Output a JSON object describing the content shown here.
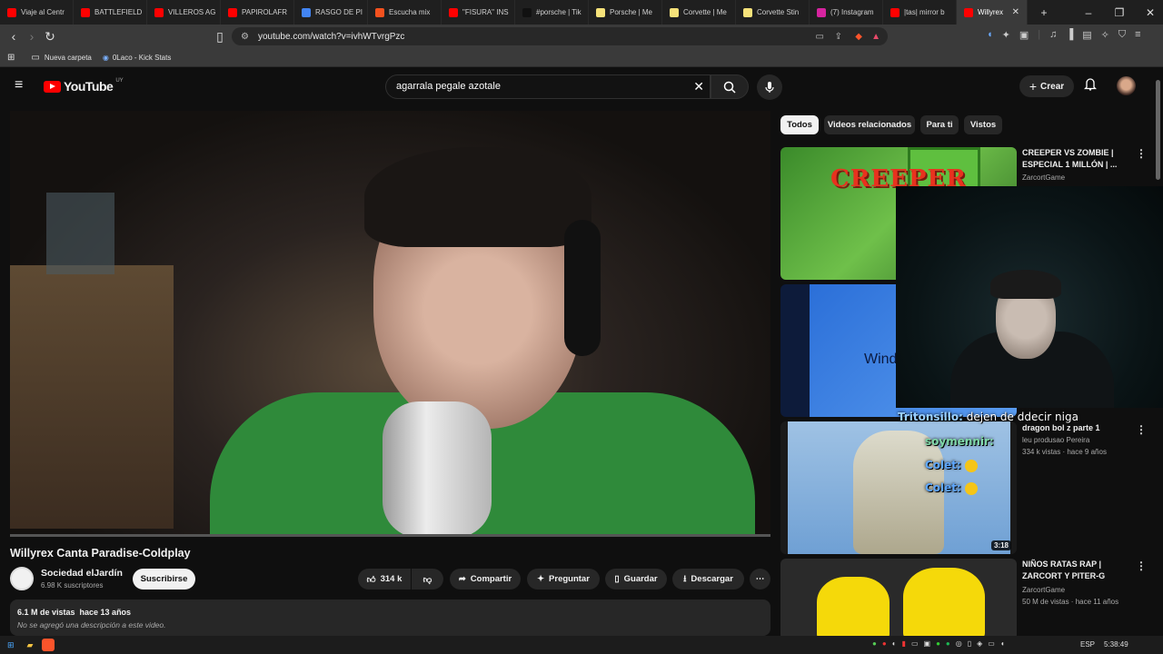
{
  "browser": {
    "tabs": [
      {
        "label": "Viaje al Centr",
        "fav": "#ff0000"
      },
      {
        "label": "BATTLEFIELD",
        "fav": "#ff0000"
      },
      {
        "label": "VILLEROS AG",
        "fav": "#ff0000"
      },
      {
        "label": "PAPIROLAFR",
        "fav": "#ff0000"
      },
      {
        "label": "RASGO DE PI",
        "fav": "#4285f4"
      },
      {
        "label": "Escucha mix",
        "fav": "#f4511e"
      },
      {
        "label": "\"FISURA\" INS",
        "fav": "#ff0000"
      },
      {
        "label": "#porsche | Tik",
        "fav": "#111111"
      },
      {
        "label": "Porsche | Me",
        "fav": "#f6e27a"
      },
      {
        "label": "Corvette | Me",
        "fav": "#f6e27a"
      },
      {
        "label": "Corvette Stin",
        "fav": "#f6e27a"
      },
      {
        "label": "(7) Instagram",
        "fav": "#d6249f"
      },
      {
        "label": "|tas| mirror b",
        "fav": "#ff0000"
      },
      {
        "label": "Willyrex",
        "fav": "#ff0000"
      }
    ],
    "url": "youtube.com/watch?v=ivhWTvrgPzc",
    "bookmarks": [
      "Nueva carpeta",
      "0Laco - Kick Stats"
    ]
  },
  "youtube": {
    "logo": "YouTube",
    "region": "UY",
    "search_query": "agarrala pegale azotale",
    "create_label": "Crear",
    "video_title": "Willyrex Canta Paradise-Coldplay",
    "channel_name": "Sociedad elJardín",
    "subscribers": "6.98 K suscriptores",
    "subscribe_label": "Suscribirse",
    "likes": "314 k",
    "share": "Compartir",
    "ask": "Preguntar",
    "save": "Guardar",
    "download": "Descargar",
    "views_date": "6.1 M de vistas  hace 13 años",
    "description": "No se agregó una descripción a este video.",
    "chips": [
      "Todos",
      "Videos relacionados",
      "Para ti",
      "Vistos"
    ],
    "related": [
      {
        "title": "CREEPER VS ZOMBIE | ESPECIAL 1 MILLÓN | ...",
        "channel": "ZarcortGame",
        "meta": ""
      },
      {
        "title": "dragon bol z parte 1",
        "channel": "leu produsao Pereira",
        "meta": "334 k vistas · hace 9 años",
        "duration": "3:18"
      },
      {
        "title": "NIÑOS RATAS RAP | ZARCORT Y PITER-G",
        "channel": "ZarcortGame",
        "meta": "50 M de vistas · hace 11 años"
      }
    ]
  },
  "chat": [
    {
      "user": "Tritonsillo:",
      "msg": "dejen de ddecir niga"
    },
    {
      "user": "soymennir:",
      "msg": ""
    },
    {
      "user": "Colet:",
      "msg": ""
    },
    {
      "user": "Colet:",
      "msg": ""
    }
  ],
  "overlay_text": {
    "creeper_art": "CREEPER",
    "windows_text": "Wind"
  },
  "taskbar": {
    "lang": "ESP",
    "time": "5:38:49"
  }
}
